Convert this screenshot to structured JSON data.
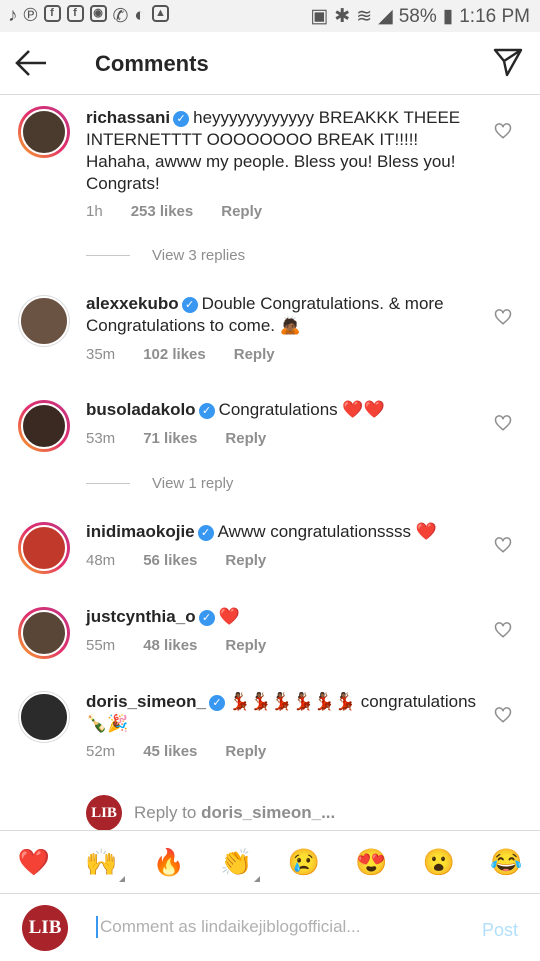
{
  "status": {
    "battery": "58%",
    "time": "1:16 PM"
  },
  "header": {
    "title": "Comments"
  },
  "comments": [
    {
      "username": "richassani",
      "text": "heyyyyyyyyyyyy BREAKKK THEEE INTERNETTTT OOOOOOOO BREAK IT!!!!! Hahaha, awww my people. Bless you! Bless you! Congrats!",
      "time": "1h",
      "likes": "253 likes",
      "reply": "Reply",
      "avatar_color": "#4a3b2e"
    },
    {
      "username": "alexxekubo",
      "text": "Double Congratulations. & more Congratulations to come. 🙇🏾",
      "time": "35m",
      "likes": "102 likes",
      "reply": "Reply",
      "avatar_color": "#6b5344"
    },
    {
      "username": "busoladakolo",
      "text": "Congratulations ❤️❤️",
      "time": "53m",
      "likes": "71 likes",
      "reply": "Reply",
      "avatar_color": "#3a2a22"
    },
    {
      "username": "inidimaokojie",
      "text": "Awww congratulationssss ❤️",
      "time": "48m",
      "likes": "56 likes",
      "reply": "Reply",
      "avatar_color": "#c0392b"
    },
    {
      "username": "justcynthia_o",
      "text": "❤️",
      "time": "55m",
      "likes": "48 likes",
      "reply": "Reply",
      "avatar_color": "#5a4636"
    },
    {
      "username": "doris_simeon_",
      "text": "💃🏾💃🏾💃🏾💃🏾💃🏾💃🏾 congratulations 🍾🎉",
      "time": "52m",
      "likes": "45 likes",
      "reply": "Reply",
      "avatar_color": "#2b2b2b"
    }
  ],
  "view_replies": [
    "View 3 replies",
    "View 1 reply"
  ],
  "reply_to": {
    "prefix": "Reply to ",
    "username": "doris_simeon_...",
    "avatar_text": "LIB"
  },
  "emoji_bar": [
    "❤️",
    "🙌",
    "🔥",
    "👏",
    "😢",
    "😍",
    "😮",
    "😂"
  ],
  "input": {
    "placeholder": "Comment as lindaikejiblogofficial...",
    "post_label": "Post",
    "avatar_text": "LIB"
  },
  "colors": {
    "link": "#3897f0",
    "heart": "#ed4956"
  }
}
